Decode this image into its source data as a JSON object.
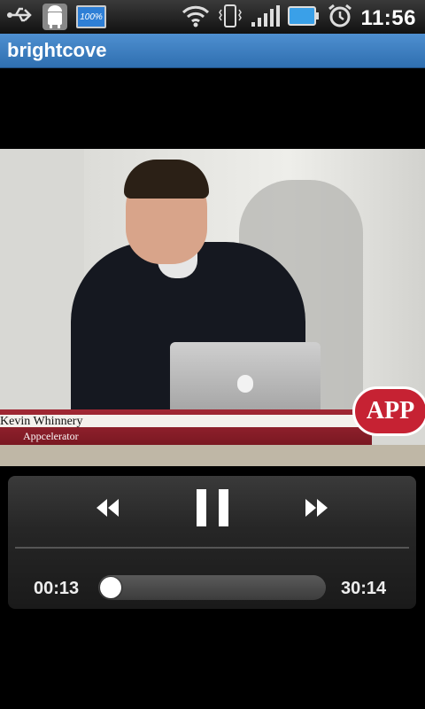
{
  "status_bar": {
    "time": "11:56",
    "battery_notification_text": "100%",
    "icons": [
      "usb-icon",
      "android-debug-icon",
      "battery-notification-icon",
      "wifi-icon",
      "vibrate-icon",
      "signal-icon",
      "battery-icon",
      "alarm-icon"
    ]
  },
  "app": {
    "title": "brightcove"
  },
  "video": {
    "lower_third_name": "Kevin Whinnery",
    "lower_third_company": "Appcelerator",
    "logo_text": "APP"
  },
  "player": {
    "current_time": "00:13",
    "total_time": "30:14",
    "progress_fraction": 0.007,
    "state": "playing",
    "controls": [
      "rewind-icon",
      "pause-icon",
      "fast-forward-icon"
    ]
  },
  "colors": {
    "title_bar": "#3f7fc0",
    "accent_red": "#a22834"
  }
}
